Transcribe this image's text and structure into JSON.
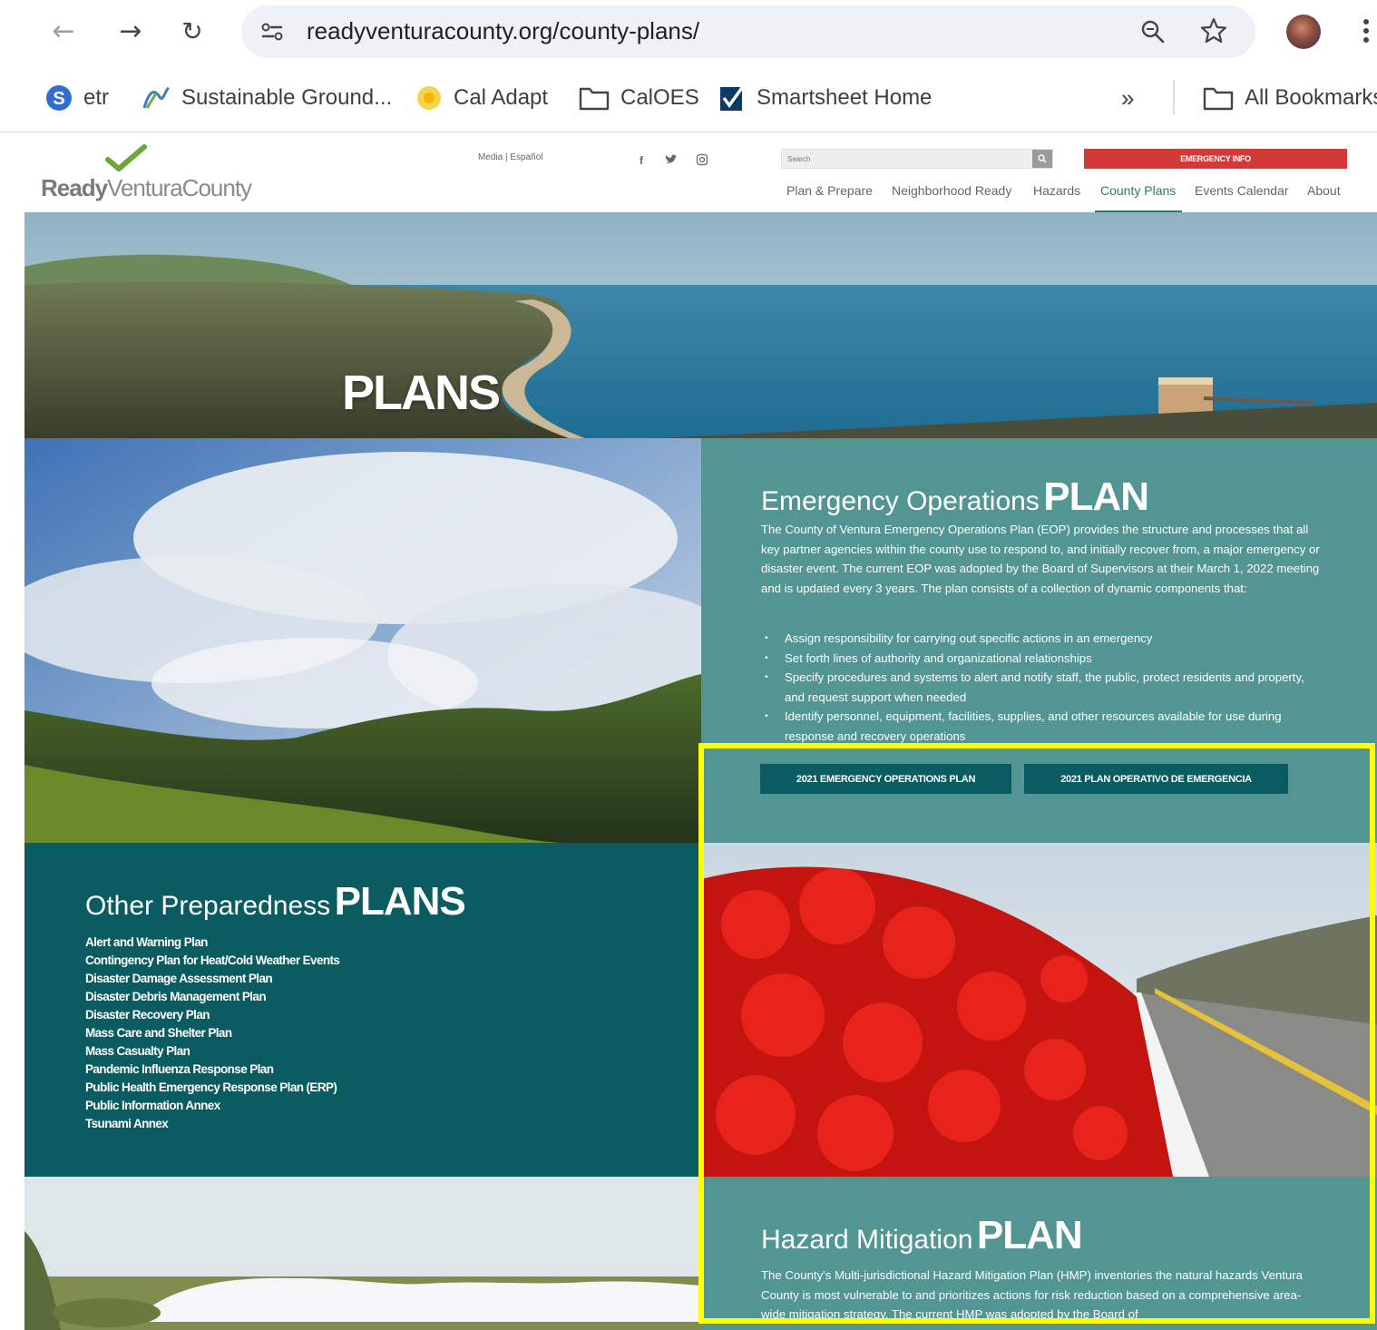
{
  "browser": {
    "url": "readyventuracounty.org/county-plans/",
    "bookmarks": [
      {
        "label": "etr",
        "icon": "s-circle-icon"
      },
      {
        "label": "Sustainable Ground...",
        "icon": "sgma-icon"
      },
      {
        "label": "Cal Adapt",
        "icon": "cal-adapt-icon"
      },
      {
        "label": "CalOES",
        "icon": "folder-icon"
      },
      {
        "label": "Smartsheet Home",
        "icon": "smartsheet-icon"
      }
    ],
    "overflow_label": "»",
    "all_bookmarks_label": "All Bookmarks"
  },
  "header": {
    "logo_ready": "Ready",
    "logo_county": "VenturaCounty",
    "util_links": "Media | Español",
    "search_placeholder": "Search",
    "emergency_label": "EMERGENCY INFO",
    "nav": [
      "Plan & Prepare",
      "Neighborhood Ready",
      "Hazards",
      "County Plans",
      "Events Calendar",
      "About"
    ],
    "active_nav": "County Plans"
  },
  "hero": {
    "title": "PLANS"
  },
  "eop": {
    "title_light": "Emergency Operations",
    "title_bold": "PLAN",
    "body": "The County of Ventura Emergency Operations Plan (EOP) provides the structure and processes that all key partner agencies within the county use to respond to, and initially recover from, a major emergency or disaster event. The current EOP was adopted by the Board of Supervisors at their March 1, 2022 meeting and is updated every 3 years. The plan consists of a collection of dynamic components that:",
    "bullets": [
      "Assign responsibility for carrying out specific actions in an emergency",
      "Set forth lines of authority and organizational relationships",
      "Specify procedures and systems to alert and notify staff, the public, protect residents and property, and request support when needed",
      "Identify personnel, equipment, facilities, supplies, and other resources available for use during response and recovery operations"
    ],
    "button_en": "2021 EMERGENCY OPERATIONS PLAN",
    "button_es": "2021 PLAN OPERATIVO DE EMERGENCIA"
  },
  "other": {
    "title_light": "Other Preparedness",
    "title_bold": "PLANS",
    "links": [
      "Alert and Warning Plan",
      "Contingency Plan for Heat/Cold Weather Events",
      "Disaster Damage Assessment Plan",
      "Disaster Debris Management Plan",
      "Disaster Recovery Plan",
      "Mass Care and Shelter Plan",
      "Mass Casualty Plan",
      "Pandemic Influenza Response Plan",
      "Public Health Emergency Response Plan (ERP)",
      "Public Information Annex",
      "Tsunami Annex"
    ]
  },
  "hmp": {
    "title_light": "Hazard Mitigation",
    "title_bold": "PLAN",
    "body": "The County's Multi-jurisdictional Hazard Mitigation Plan (HMP) inventories the natural hazards Ventura County is most vulnerable to and prioritizes actions for risk reduction based on a comprehensive area-wide mitigation strategy. The current HMP was adopted by the Board of"
  },
  "colors": {
    "teal": "#529592",
    "dark_teal": "#0b5c61",
    "emergency_red": "#d23a3a",
    "highlight": "#ffff00"
  }
}
